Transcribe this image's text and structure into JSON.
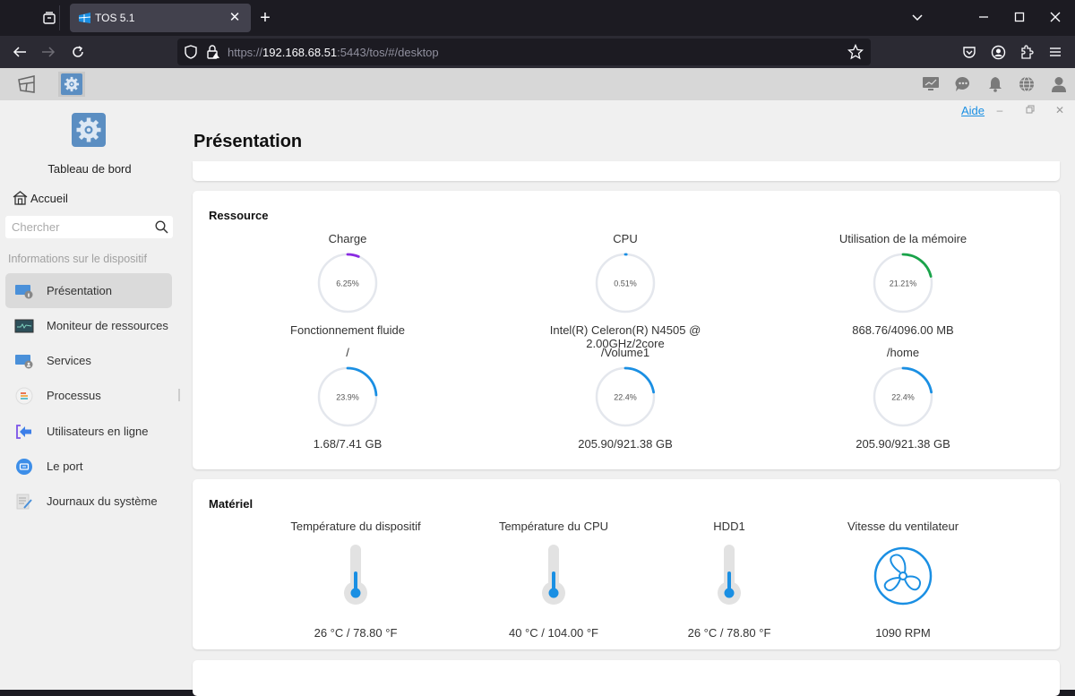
{
  "browser": {
    "tab_title": "TOS 5.1",
    "url_prefix": "https://",
    "url_host": "192.168.68.51",
    "url_rest": ":5443/tos/#/desktop"
  },
  "window": {
    "help_label": "Aide"
  },
  "sidebar": {
    "app_title": "Tableau de bord",
    "home_label": "Accueil",
    "search_placeholder": "Chercher",
    "section_label": "Informations sur le dispositif",
    "items": [
      {
        "label": "Présentation",
        "icon": "presentation-icon",
        "active": true
      },
      {
        "label": "Moniteur de ressources",
        "icon": "resource-monitor-icon"
      },
      {
        "label": "Services",
        "icon": "services-icon"
      },
      {
        "label": "Processus",
        "icon": "process-icon"
      },
      {
        "label": "Utilisateurs en ligne",
        "icon": "online-users-icon"
      },
      {
        "label": "Le port",
        "icon": "port-icon"
      },
      {
        "label": "Journaux du système",
        "icon": "system-logs-icon"
      }
    ]
  },
  "main": {
    "title": "Présentation",
    "resource": {
      "title": "Ressource",
      "gauges": [
        {
          "label": "Charge",
          "value_text": "6.25%",
          "percent": 6.25,
          "color": "#8a2be2",
          "sub": "Fonctionnement fluide"
        },
        {
          "label": "CPU",
          "value_text": "0.51%",
          "percent": 0.51,
          "color": "#1a8fe3",
          "sub": "Intel(R) Celeron(R) N4505 @ 2.00GHz/2core"
        },
        {
          "label": "Utilisation de la mémoire",
          "value_text": "21.21%",
          "percent": 21.21,
          "color": "#1aa34a",
          "sub": "868.76/4096.00 MB"
        },
        {
          "label": "/",
          "value_text": "23.9%",
          "percent": 23.9,
          "color": "#1a8fe3",
          "sub": "1.68/7.41 GB"
        },
        {
          "label": "/Volume1",
          "value_text": "22.4%",
          "percent": 22.4,
          "color": "#1a8fe3",
          "sub": "205.90/921.38 GB"
        },
        {
          "label": "/home",
          "value_text": "22.4%",
          "percent": 22.4,
          "color": "#1a8fe3",
          "sub": "205.90/921.38 GB"
        }
      ]
    },
    "hardware": {
      "title": "Matériel",
      "items": [
        {
          "label": "Température du dispositif",
          "value": "26 °C / 78.80 °F",
          "type": "thermometer"
        },
        {
          "label": "Température du CPU",
          "value": "40 °C / 104.00 °F",
          "type": "thermometer"
        },
        {
          "label": "HDD1",
          "value": "26 °C / 78.80 °F",
          "type": "thermometer"
        },
        {
          "label": "Vitesse du ventilateur",
          "value": "1090 RPM",
          "type": "fan"
        }
      ]
    }
  }
}
